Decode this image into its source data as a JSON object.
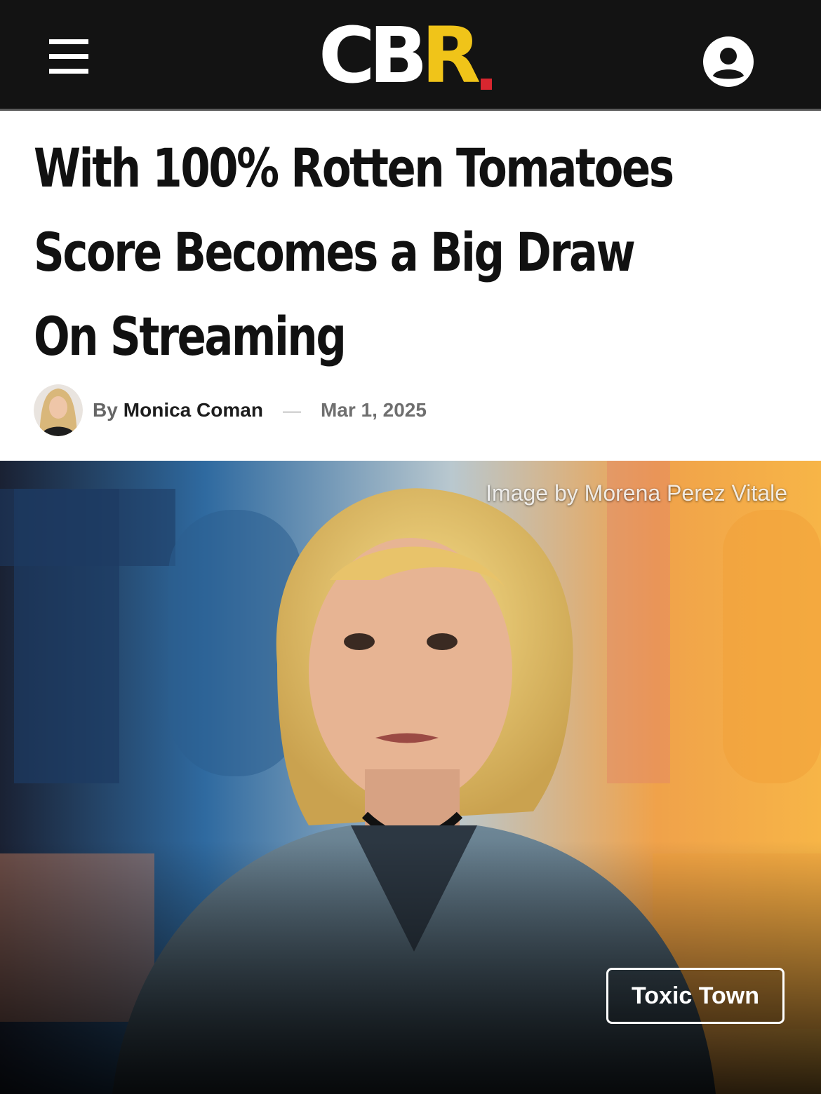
{
  "header": {
    "logo": {
      "text_main": "CB",
      "text_accent": "R",
      "accent_color": "#f0c419",
      "dot_color": "#d8262f"
    },
    "menu_icon": "hamburger-menu-icon",
    "account_icon": "user-account-icon",
    "background_color": "#131313"
  },
  "article": {
    "headline_lines": [
      "With 100% Rotten Tomatoes",
      "Score Becomes a Big Draw",
      "On Streaming"
    ],
    "byline": {
      "by_label": "By",
      "author": "Monica Coman",
      "separator": "—",
      "date": "Mar 1, 2025"
    }
  },
  "hero": {
    "credit": "Image by Morena Perez Vitale",
    "tag_button": "Toxic Town"
  }
}
